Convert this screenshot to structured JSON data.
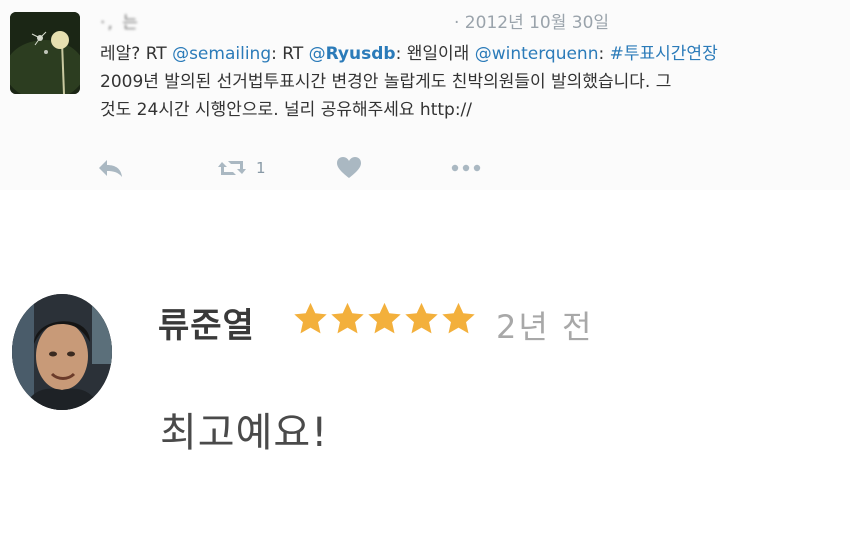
{
  "tweet": {
    "author_name": "·, 는",
    "time_label": "· 2012년 10월 30일",
    "text": {
      "prefix": "레알? RT ",
      "mention1": "@semailing",
      "sep1": ": RT ",
      "mention2_at": "@",
      "mention2_name": "Ryusdb",
      "sep2": ": 왠일이래 ",
      "mention3": "@winterquenn",
      "sep3": ": ",
      "hashtag": "#투표시간연장",
      "line2": "2009년 발의된 선거법투표시간 변경안 놀랍게도 친박의원들이 발의했습니다. 그",
      "line3": "것도 24시간 시행안으로. 널리 공유해주세요 http://"
    },
    "actions": {
      "reply_icon": "reply-arrow-icon",
      "retweet_icon": "retweet-icon",
      "retweet_count": "1",
      "like_icon": "heart-icon",
      "more_icon": "more-dots-icon"
    }
  },
  "review": {
    "author_name": "류준열",
    "rating": 5,
    "rating_max": 5,
    "time_label": "2년 전",
    "body": "최고예요!",
    "star_color": "#f3b03c"
  }
}
